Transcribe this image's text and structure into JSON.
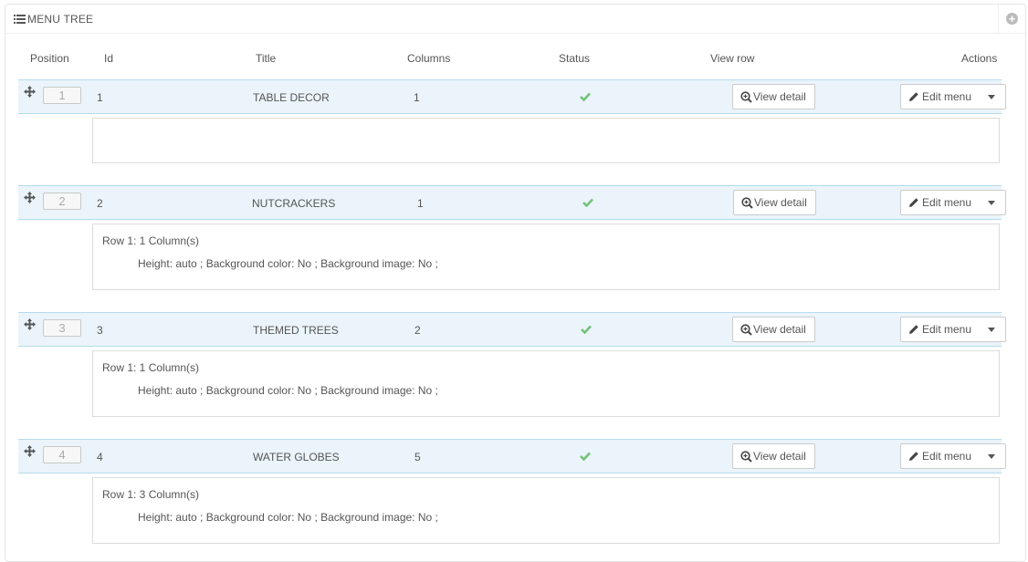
{
  "panel": {
    "title": "MENU TREE",
    "title_icon": "list-icon",
    "add_icon": "plus-circle-icon"
  },
  "columns": {
    "position": "Position",
    "id": "Id",
    "title": "Title",
    "columns": "Columns",
    "status": "Status",
    "view_row": "View row",
    "actions": "Actions"
  },
  "rows": [
    {
      "position": "1",
      "id": "1",
      "title": "TABLE DECOR",
      "columns": "1",
      "status": "enabled",
      "view_label": "View detail",
      "edit_label": "Edit menu",
      "detail_row": "",
      "detail_props": ""
    },
    {
      "position": "2",
      "id": "2",
      "title": "NUTCRACKERS",
      "columns": "1",
      "status": "enabled",
      "view_label": "View detail",
      "edit_label": "Edit menu",
      "detail_row": "Row 1: 1 Column(s)",
      "detail_props": "Height: auto ; Background color: No ; Background image: No ;"
    },
    {
      "position": "3",
      "id": "3",
      "title": "THEMED TREES",
      "columns": "2",
      "status": "enabled",
      "view_label": "View detail",
      "edit_label": "Edit menu",
      "detail_row": "Row 1: 1 Column(s)",
      "detail_props": "Height: auto ; Background color: No ; Background image: No ;"
    },
    {
      "position": "4",
      "id": "4",
      "title": "WATER GLOBES",
      "columns": "5",
      "status": "enabled",
      "view_label": "View detail",
      "edit_label": "Edit menu",
      "detail_row": "Row 1: 3 Column(s)",
      "detail_props": "Height: auto ; Background color: No ; Background image: No ;"
    }
  ],
  "colors": {
    "row_band": "#eaf4fa",
    "row_border": "#b5dbee",
    "status_ok": "#72c279"
  }
}
